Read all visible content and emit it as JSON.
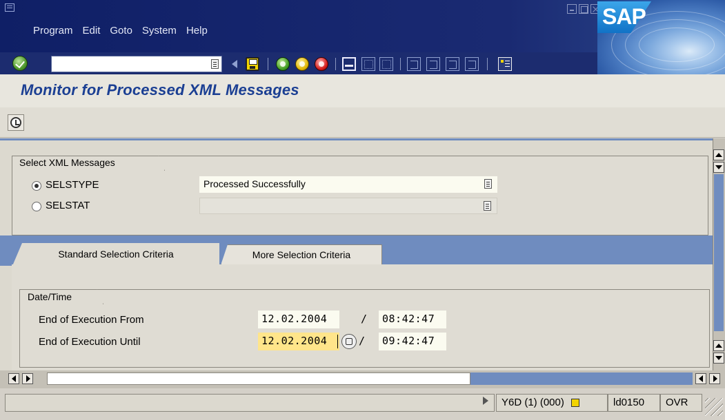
{
  "menubar": {
    "items": [
      "Program",
      "Edit",
      "Goto",
      "System",
      "Help"
    ]
  },
  "brand": {
    "logo_text": "SAP",
    "color": "#1172c6"
  },
  "toolbar": {
    "command_field_value": "",
    "icons": [
      "check-icon",
      "history-icon",
      "back-icon",
      "save-icon",
      "back-green-icon",
      "exit-icon",
      "cancel-icon",
      "print-icon",
      "find-icon",
      "find-next-icon",
      "first-page-icon",
      "prev-page-icon",
      "next-page-icon",
      "last-page-icon",
      "layout-menu-icon"
    ]
  },
  "page": {
    "title": "Monitor for Processed XML Messages"
  },
  "app_toolbar": {
    "execute_icon": "execute-icon"
  },
  "select_group": {
    "label": "Select XML Messages",
    "options": [
      {
        "label": "SELSTYPE",
        "checked": true,
        "value": "Processed Successfully"
      },
      {
        "label": "SELSTAT",
        "checked": false,
        "value": ""
      }
    ]
  },
  "tabs": [
    {
      "label": "Standard Selection Criteria",
      "active": true
    },
    {
      "label": "More Selection Criteria",
      "active": false
    }
  ],
  "datetime_group": {
    "label": "Date/Time",
    "rows": [
      {
        "label": "End of Execution From",
        "date": "12.02.2004",
        "time": "08:42:47"
      },
      {
        "label": "End of Execution Until",
        "date": "12.02.2004",
        "time": "09:42:47"
      }
    ],
    "separator": "/"
  },
  "statusbar": {
    "system": "Y6D (1) (000)",
    "server": "ld0150",
    "mode": "OVR"
  },
  "colors": {
    "title_blue": "#1b3f93",
    "menu_bg": "#1c2c6f",
    "focus_field": "#ffe58a",
    "tab_strip": "#6f8cbf"
  }
}
